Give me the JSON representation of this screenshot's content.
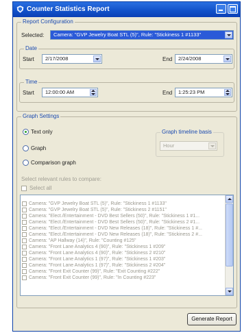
{
  "window": {
    "title": "Counter Statistics Report"
  },
  "report_config": {
    "group_label": "Report Configuration",
    "selected_label": "Selected:",
    "selected_value": "Camera: \"GVP Jewelry Boat STL (5)\", Rule: \"Stickiness 1 #1133\""
  },
  "date": {
    "group_label": "Date",
    "start_label": "Start",
    "start_value": "2/17/2008",
    "end_label": "End",
    "end_value": "2/24/2008"
  },
  "time": {
    "group_label": "Time",
    "start_label": "Start",
    "start_value": "12:00:00 AM",
    "end_label": "End",
    "end_value": "1:25:23 PM"
  },
  "graph_settings": {
    "group_label": "Graph Settings",
    "options": [
      {
        "label": "Text only",
        "selected": true
      },
      {
        "label": "Graph",
        "selected": false
      },
      {
        "label": "Comparison graph",
        "selected": false
      }
    ],
    "timeline_label": "Graph timeline basis",
    "timeline_value": "Hour",
    "compare_hint": "Select relevant rules to compare:",
    "select_all_label": "Select all",
    "rules": [
      "Camera: \"GVP Jewelry Boat STL (5)\", Rule: \"Stickiness 1 #1133\"",
      "Camera: \"GVP Jewelry Boat STL (5)\", Rule: \"Stickiness 2 #1151\"",
      "Camera: \"Elect./Entertainment - DVD Best Sellers (50)\", Rule: \"Stickiness 1 #1...",
      "Camera: \"Elect./Entertainment - DVD Best Sellers (50)\", Rule: \"Stickiness 2 #1...",
      "Camera: \"Elect./Entertainment - DVD New Releases (18)\", Rule: \"Stickiness 1 #...",
      "Camera: \"Elect./Entertainment - DVD New Releases (18)\", Rule: \"Stickiness 2 #...",
      "Camera: \"AP Hallway (14)\", Rule: \"Counting #125\"",
      "Camera: \"Front Lane Analytics 4 (90)\", Rule: \"Stickiness 1 #209\"",
      "Camera: \"Front Lane Analytics 4 (90)\", Rule: \"Stickiness 2 #210\"",
      "Camera: \"Front Lane Analytics 1 (97)\", Rule: \"Stickiness 1 #203\"",
      "Camera: \"Front Lane Analytics 1 (97)\", Rule: \"Stickiness 2 #204\"",
      "Camera: \"Front Exit Counter (99)\", Rule: \"Exit Counting #222\"",
      "Camera: \"Front Exit Counter (99)\", Rule: \"In Counting #223\""
    ]
  },
  "footer": {
    "generate_label": "Generate Report"
  }
}
